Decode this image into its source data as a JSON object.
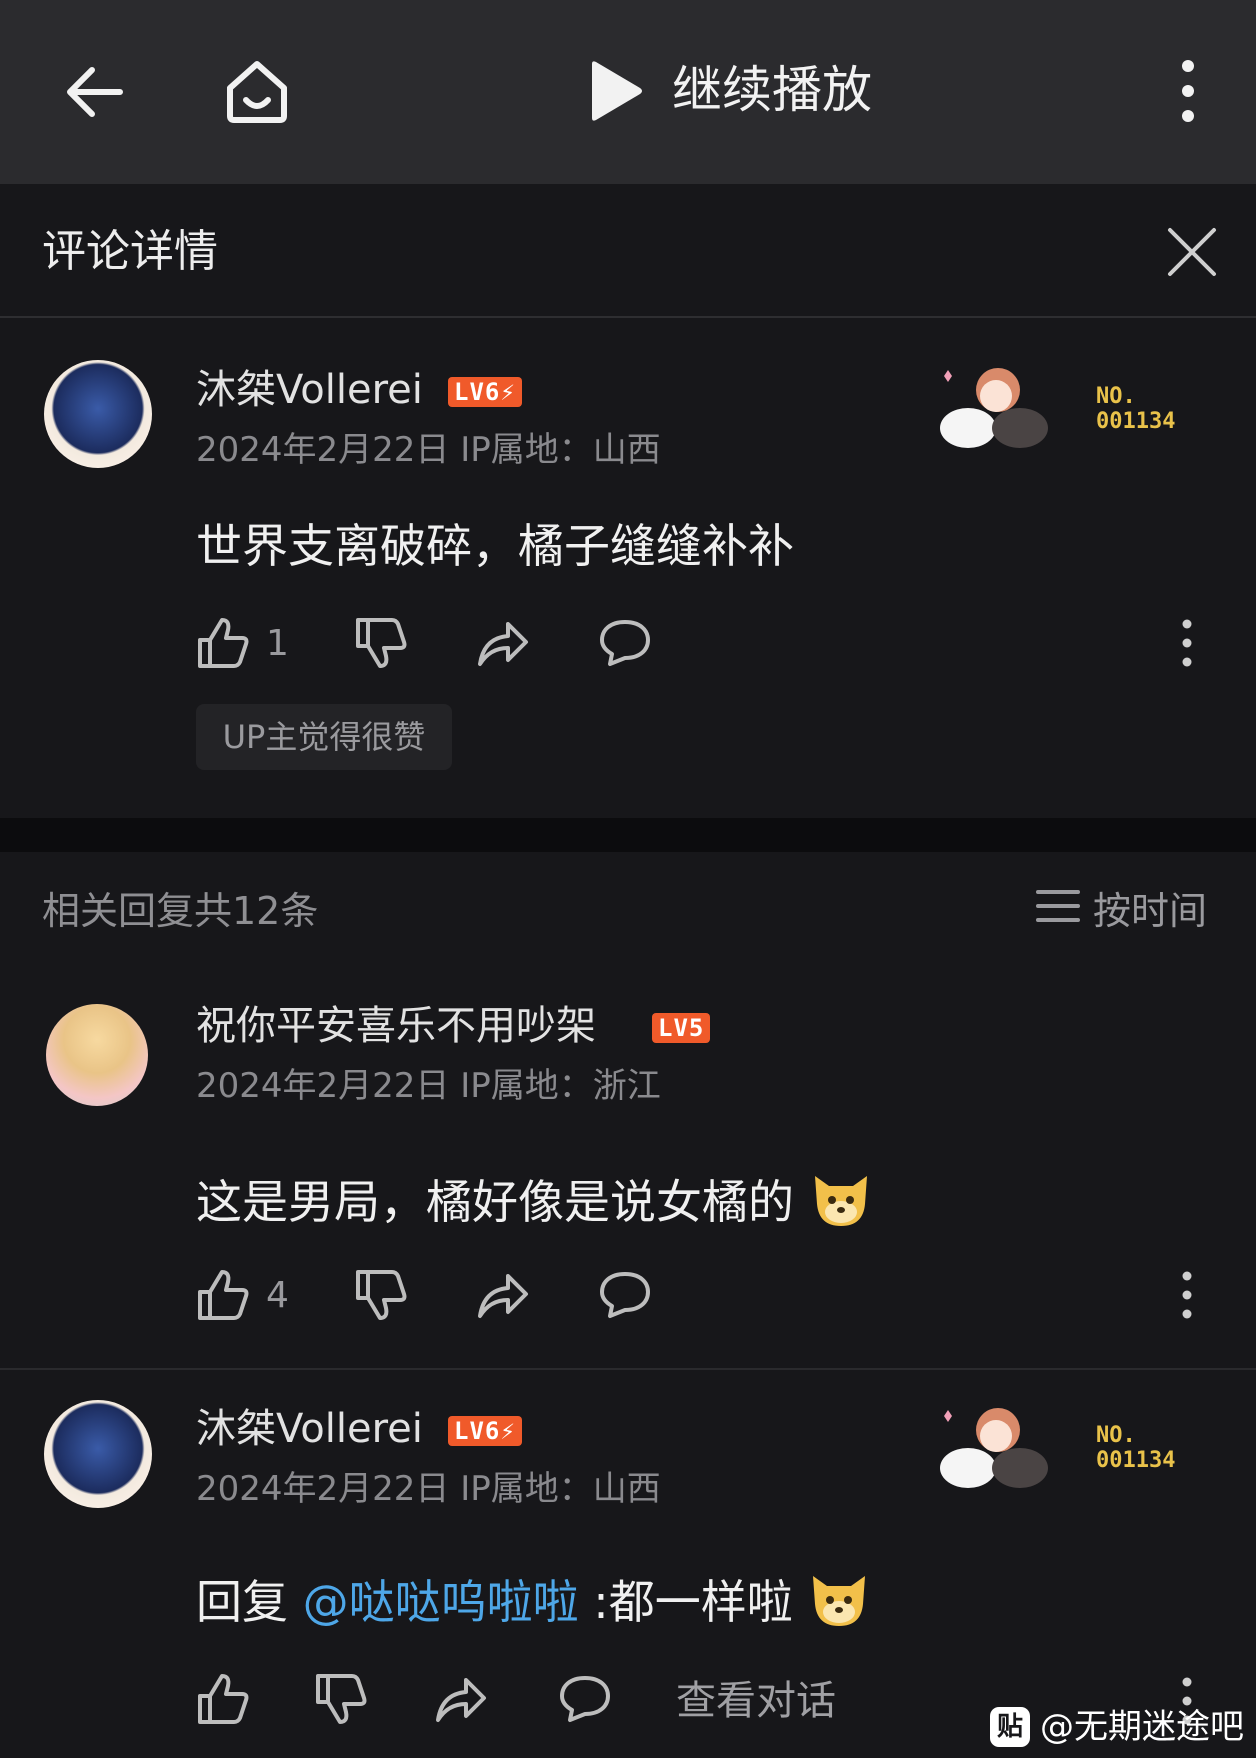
{
  "topbar": {
    "title": "继续播放"
  },
  "sheet": {
    "title": "评论详情"
  },
  "main_comment": {
    "user": "沐桀Vollerei",
    "level": "LV6⚡",
    "meta": "2024年2月22日 IP属地：山西",
    "fan_no_label": "NO.",
    "fan_no": "001134",
    "text": "世界支离破碎，橘子缝缝补补",
    "likes": "1",
    "up_badge": "UP主觉得很赞"
  },
  "replies_header": {
    "count_label": "相关回复共12条",
    "sort_label": "按时间"
  },
  "replies": [
    {
      "user": "祝你平安喜乐不用吵架",
      "level": "LV5",
      "meta": "2024年2月22日 IP属地：浙江",
      "text": "这是男局，橘好像是说女橘的",
      "likes": "4"
    },
    {
      "user": "沐桀Vollerei",
      "level": "LV6⚡",
      "meta": "2024年2月22日 IP属地：山西",
      "fan_no_label": "NO.",
      "fan_no": "001134",
      "reply_prefix": "回复 ",
      "mention": "@哒哒呜啦啦",
      "text": " :都一样啦",
      "view_conversation": "查看对话"
    }
  ],
  "watermark": {
    "logo": "贴",
    "text": "@无期迷途吧"
  },
  "colors": {
    "background": "#17171a",
    "topbar": "#2b2b2e",
    "level_badge": "#f05a2a",
    "mention": "#4ea7e8",
    "fan_number": "#e9c24a"
  }
}
